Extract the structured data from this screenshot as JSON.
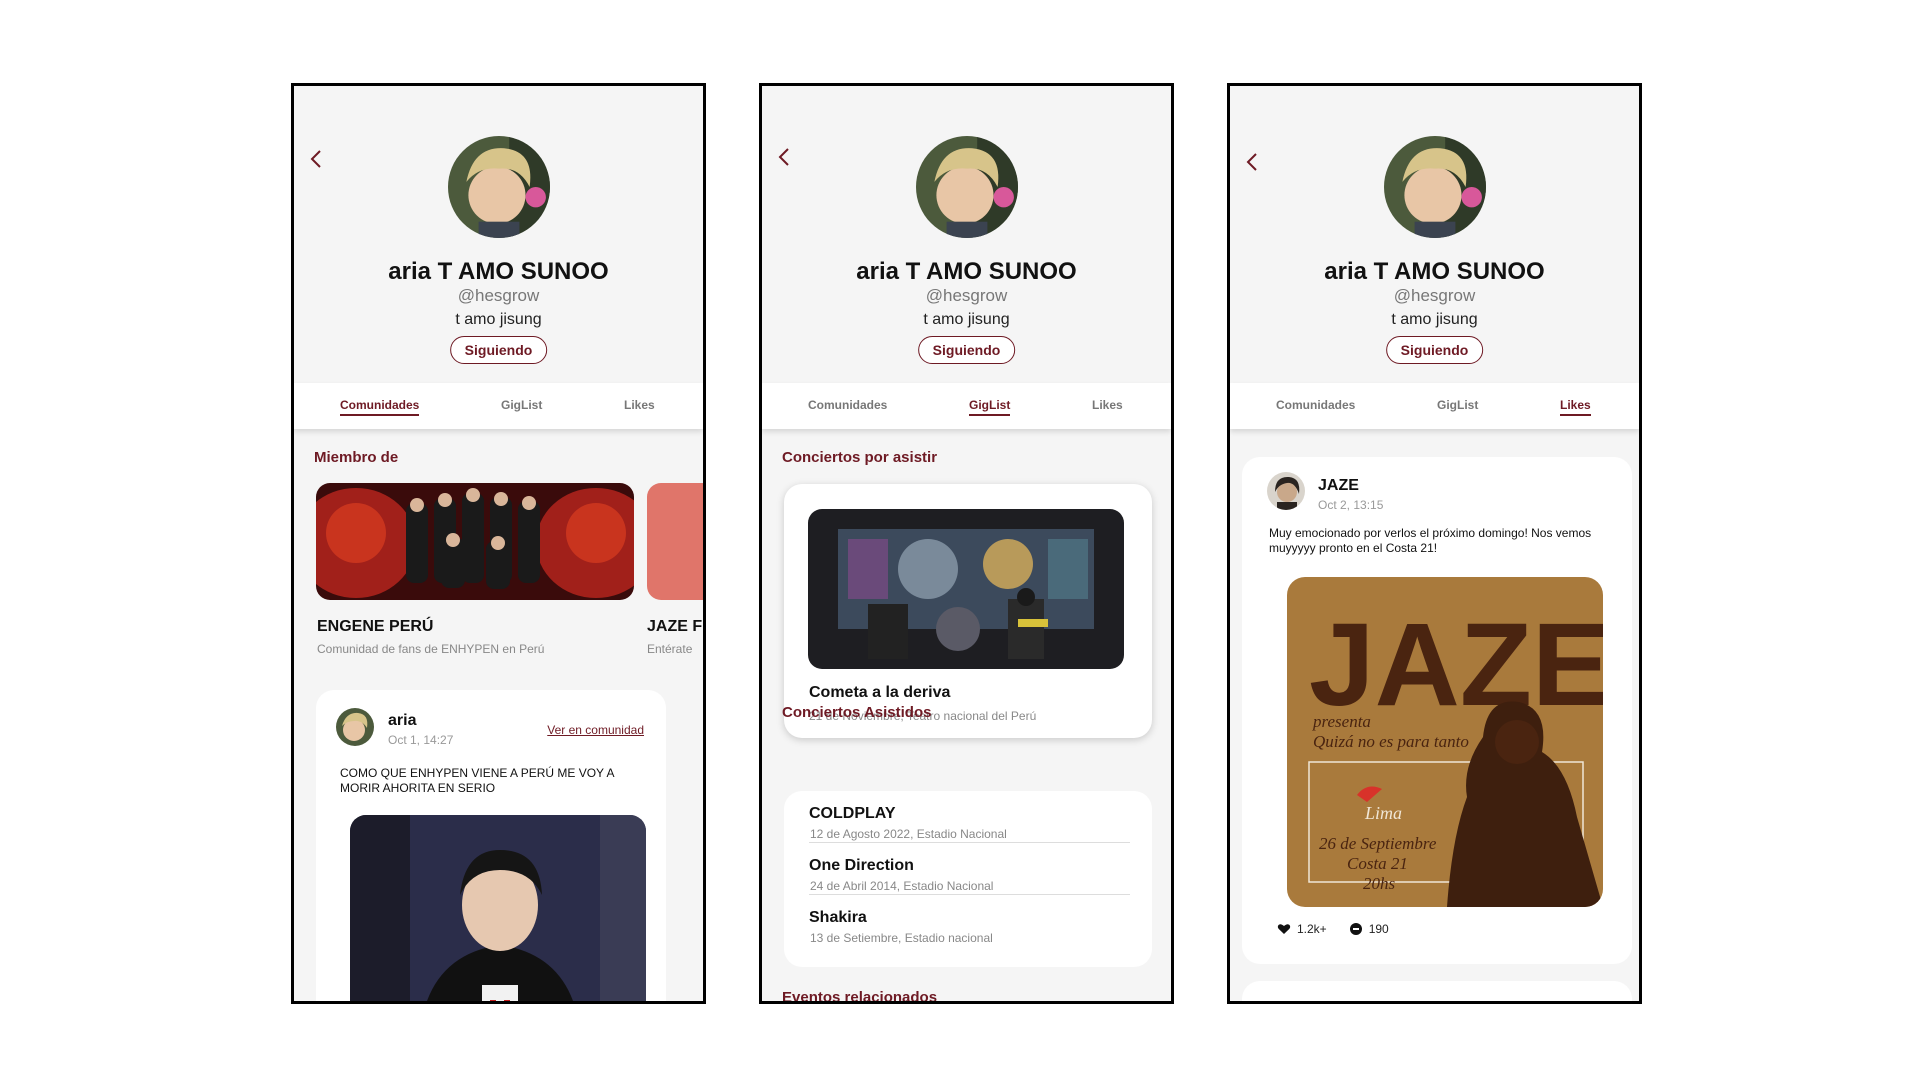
{
  "profile": {
    "name": "aria T AMO SUNOO",
    "handle": "@hesgrow",
    "bio": "t amo jisung",
    "follow_label": "Siguiendo"
  },
  "tabs": [
    "Comunidades",
    "GigList",
    "Likes"
  ],
  "screen_comunidades": {
    "section_title": "Miembro de",
    "communities": [
      {
        "name": "ENGENE PERÚ",
        "description": "Comunidad de fans de ENHYPEN en  Perú"
      },
      {
        "name": "JAZE F",
        "description": "Entérate"
      }
    ],
    "post": {
      "author": "aria",
      "time": "Oct 1, 14:27",
      "link": "Ver en comunidad",
      "text": "COMO QUE ENHYPEN VIENE A PERÚ ME VOY A MORIR AHORITA EN SERIO"
    }
  },
  "screen_giglist": {
    "upcoming_title": "Conciertos por asistir",
    "upcoming": {
      "name": "Cometa a la deriva",
      "detail": "21 de Noviembre, Teatro nacional del Perú"
    },
    "attended_title": "Conciertos Asistidos",
    "attended": [
      {
        "name": "COLDPLAY",
        "detail": "12 de Agosto 2022, Estadio Nacional"
      },
      {
        "name": "One Direction",
        "detail": "24 de Abril 2014, Estadio Nacional"
      },
      {
        "name": "Shakira",
        "detail": "13 de Setiembre, Estadio nacional"
      }
    ],
    "related_title": "Eventos relacionados"
  },
  "screen_likes": {
    "post": {
      "author": "JAZE",
      "time": "Oct 2, 13:15",
      "text": "Muy emocionado por verlos el próximo domingo! Nos vemos muyyyyy pronto en el Costa 21!",
      "likes": "1.2k+",
      "comments": "190"
    },
    "poster": {
      "title": "JAZE",
      "presenta": "presenta",
      "album": "Quizá no es para tanto",
      "city": "Lima",
      "date": "26 de Septiembre",
      "venue": "Costa 21",
      "hour": "20hs"
    }
  },
  "colors": {
    "accent": "#6e1a24",
    "background": "#f5f5f5",
    "card": "#ffffff"
  }
}
